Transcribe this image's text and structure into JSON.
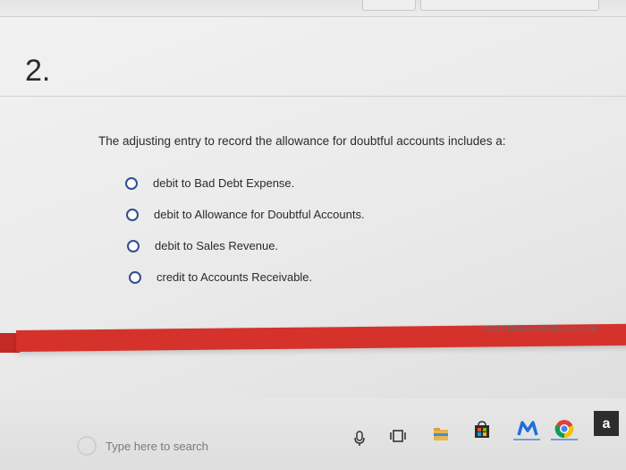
{
  "question": {
    "number": "2.",
    "prompt": "The adjusting entry to record the allowance for doubtful accounts includes a:",
    "options": [
      {
        "label": "debit to Bad Debt Expense."
      },
      {
        "label": "debit to Allowance for Doubtful Accounts."
      },
      {
        "label": "debit to Sales Revenue."
      },
      {
        "label": "credit to Accounts Receivable."
      }
    ]
  },
  "footer": {
    "copyright": "©2017 McGraw-Hill Education. All"
  },
  "taskbar": {
    "search_placeholder": "Type here to search",
    "amazon_letter": "a"
  },
  "colors": {
    "accent_red": "#d6322c",
    "radio_border": "#2f4f8f"
  }
}
